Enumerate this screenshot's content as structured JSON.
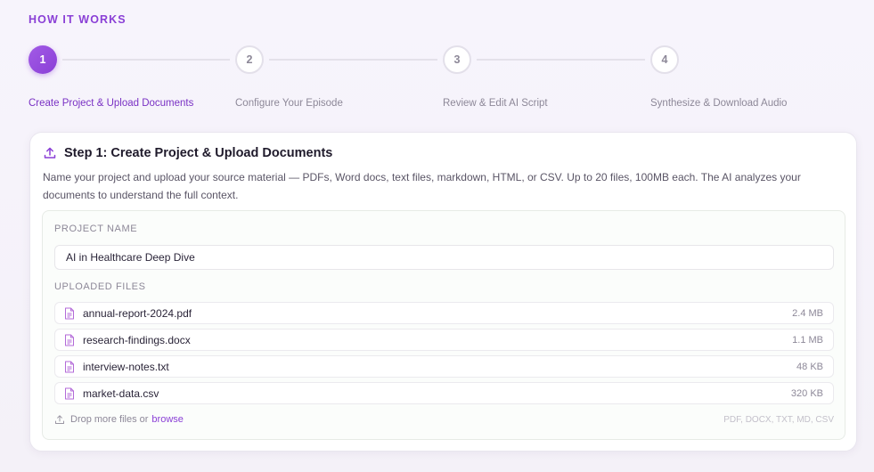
{
  "section_title": "HOW IT WORKS",
  "steps": [
    {
      "number": "1",
      "label": "Create Project & Upload Documents",
      "active": true
    },
    {
      "number": "2",
      "label": "Configure Your Episode",
      "active": false
    },
    {
      "number": "3",
      "label": "Review & Edit AI Script",
      "active": false
    },
    {
      "number": "4",
      "label": "Synthesize & Download Audio",
      "active": false
    }
  ],
  "card": {
    "icon": "upload-icon",
    "title": "Step 1: Create Project & Upload Documents",
    "description": "Name your project and upload your source material — PDFs, Word docs, text files, markdown, HTML, or CSV. Up to 20 files, 100MB each. The AI analyzes your documents to understand the full context.",
    "project_name_label": "PROJECT NAME",
    "project_name_value": "AI in Healthcare Deep Dive",
    "uploaded_files_label": "UPLOADED FILES",
    "files": [
      {
        "name": "annual-report-2024.pdf",
        "size": "2.4 MB"
      },
      {
        "name": "research-findings.docx",
        "size": "1.1 MB"
      },
      {
        "name": "interview-notes.txt",
        "size": "48 KB"
      },
      {
        "name": "market-data.csv",
        "size": "320 KB"
      }
    ],
    "drop_text": "Drop more files or",
    "browse_label": "browse",
    "formats": "PDF, DOCX, TXT, MD, CSV"
  },
  "colors": {
    "accent": "#8a3fd6",
    "file_icon": "#b36ad8"
  }
}
